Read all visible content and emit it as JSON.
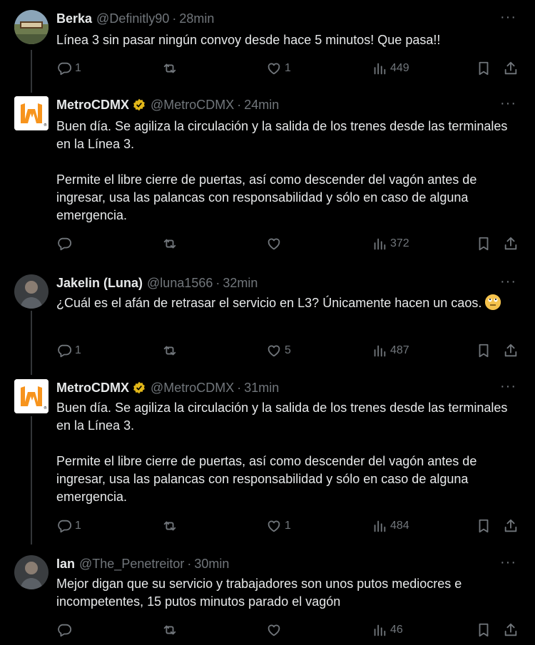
{
  "tweets": [
    {
      "name": "Berka",
      "handle": "@Definitly90",
      "time": "28min",
      "text": "Línea 3 sin pasar ningún convoy desde hace 5 minutos! Que pasa!!",
      "replies": "1",
      "retweets": "",
      "likes": "1",
      "views": "449",
      "avatar": "landscape-photo"
    },
    {
      "name": "MetroCDMX",
      "handle": "@MetroCDMX",
      "time": "24min",
      "text": "Buen día. Se agiliza la circulación y la salida de los trenes desde las terminales en la Línea 3.\n\nPermite el libre cierre de puertas, así como descender del vagón antes de ingresar, usa las palancas con responsabilidad y sólo en caso de alguna emergencia.",
      "replies": "",
      "retweets": "",
      "likes": "",
      "views": "372",
      "avatar": "metro-logo"
    },
    {
      "name": "Jakelin (Luna)",
      "handle": "@luna1566",
      "time": "32min",
      "text": "¿Cuál es el afán de retrasar el servicio en L3? Únicamente hacen un caos.",
      "emoji": "face-with-rolling-eyes",
      "replies": "1",
      "retweets": "",
      "likes": "5",
      "views": "487",
      "avatar": "person-photo"
    },
    {
      "name": "MetroCDMX",
      "handle": "@MetroCDMX",
      "time": "31min",
      "text": "Buen día. Se agiliza la circulación y la salida de los trenes desde las terminales en la Línea 3.\n\nPermite el libre cierre de puertas, así como descender del vagón antes de ingresar, usa las palancas con responsabilidad y sólo en caso de alguna emergencia.",
      "replies": "1",
      "retweets": "",
      "likes": "1",
      "views": "484",
      "avatar": "metro-logo"
    },
    {
      "name": "Ian",
      "handle": "@The_Penetreitor",
      "time": "30min",
      "text": "Mejor digan que su servicio y trabajadores son unos putos mediocres e incompetentes, 15 putos minutos parado el vagón",
      "replies": "",
      "retweets": "",
      "likes": "",
      "views": "46",
      "avatar": "person-photo"
    }
  ],
  "separator": "·",
  "colors": {
    "background": "#000000",
    "text": "#e7e9ea",
    "muted": "#71767b",
    "verified": "#e2b719",
    "metro_orange": "#f7941d"
  }
}
